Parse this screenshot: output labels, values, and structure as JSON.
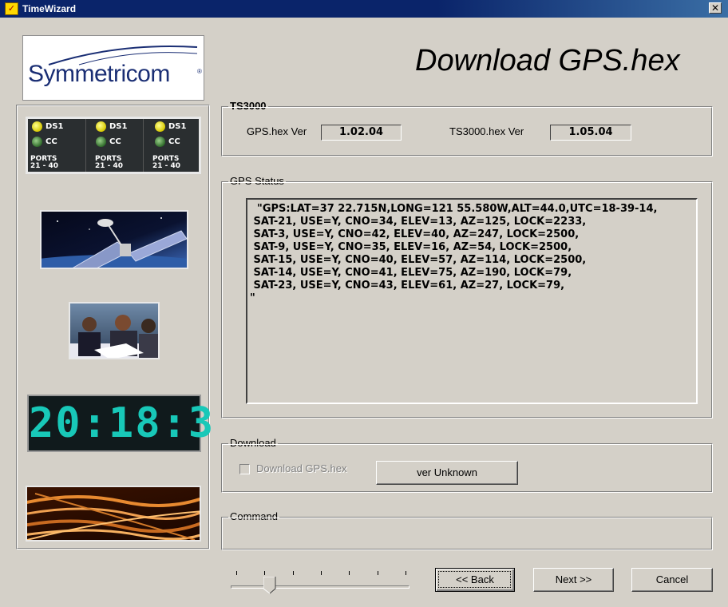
{
  "window": {
    "title": "TimeWizard",
    "close_glyph": "✕"
  },
  "logo": {
    "text": "Symmetricom",
    "reg": "®"
  },
  "images": {
    "ports_panel": {
      "columns": [
        {
          "led1_label": "DS1",
          "led2_label": "CC",
          "ports_line1": "PORTS",
          "ports_line2": "21 - 40"
        },
        {
          "led1_label": "DS1",
          "led2_label": "CC",
          "ports_line1": "PORTS",
          "ports_line2": "21 - 40"
        },
        {
          "led1_label": "DS1",
          "led2_label": "CC",
          "ports_line1": "PORTS",
          "ports_line2": "21 - 40"
        }
      ]
    },
    "clock_display": "20:18:3"
  },
  "page": {
    "title": "Download GPS.hex"
  },
  "ts3000": {
    "group_label": "TS3000",
    "gps_hex_label": "GPS.hex Ver",
    "gps_hex_value": "1.02.04",
    "ts3000_hex_label": "TS3000.hex Ver",
    "ts3000_hex_value": "1.05.04"
  },
  "gps_status": {
    "group_label": "GPS Status",
    "text": "  \"GPS:LAT=37 22.715N,LONG=121 55.580W,ALT=44.0,UTC=18-39-14,\n SAT-21, USE=Y, CNO=34, ELEV=13, AZ=125, LOCK=2233,\n SAT-3, USE=Y, CNO=42, ELEV=40, AZ=247, LOCK=2500,\n SAT-9, USE=Y, CNO=35, ELEV=16, AZ=54, LOCK=2500,\n SAT-15, USE=Y, CNO=40, ELEV=57, AZ=114, LOCK=2500,\n SAT-14, USE=Y, CNO=41, ELEV=75, AZ=190, LOCK=79,\n SAT-23, USE=Y, CNO=43, ELEV=61, AZ=27, LOCK=79,\n\""
  },
  "download": {
    "group_label": "Download",
    "checkbox_label": "Download GPS.hex",
    "checkbox_checked": false,
    "checkbox_enabled": false,
    "version_button_label": "ver Unknown"
  },
  "command": {
    "group_label": "Command"
  },
  "slider": {
    "tick_count": 7,
    "position_fraction": 0.2
  },
  "buttons": {
    "back": "<< Back",
    "next": "Next >>",
    "cancel": "Cancel"
  }
}
